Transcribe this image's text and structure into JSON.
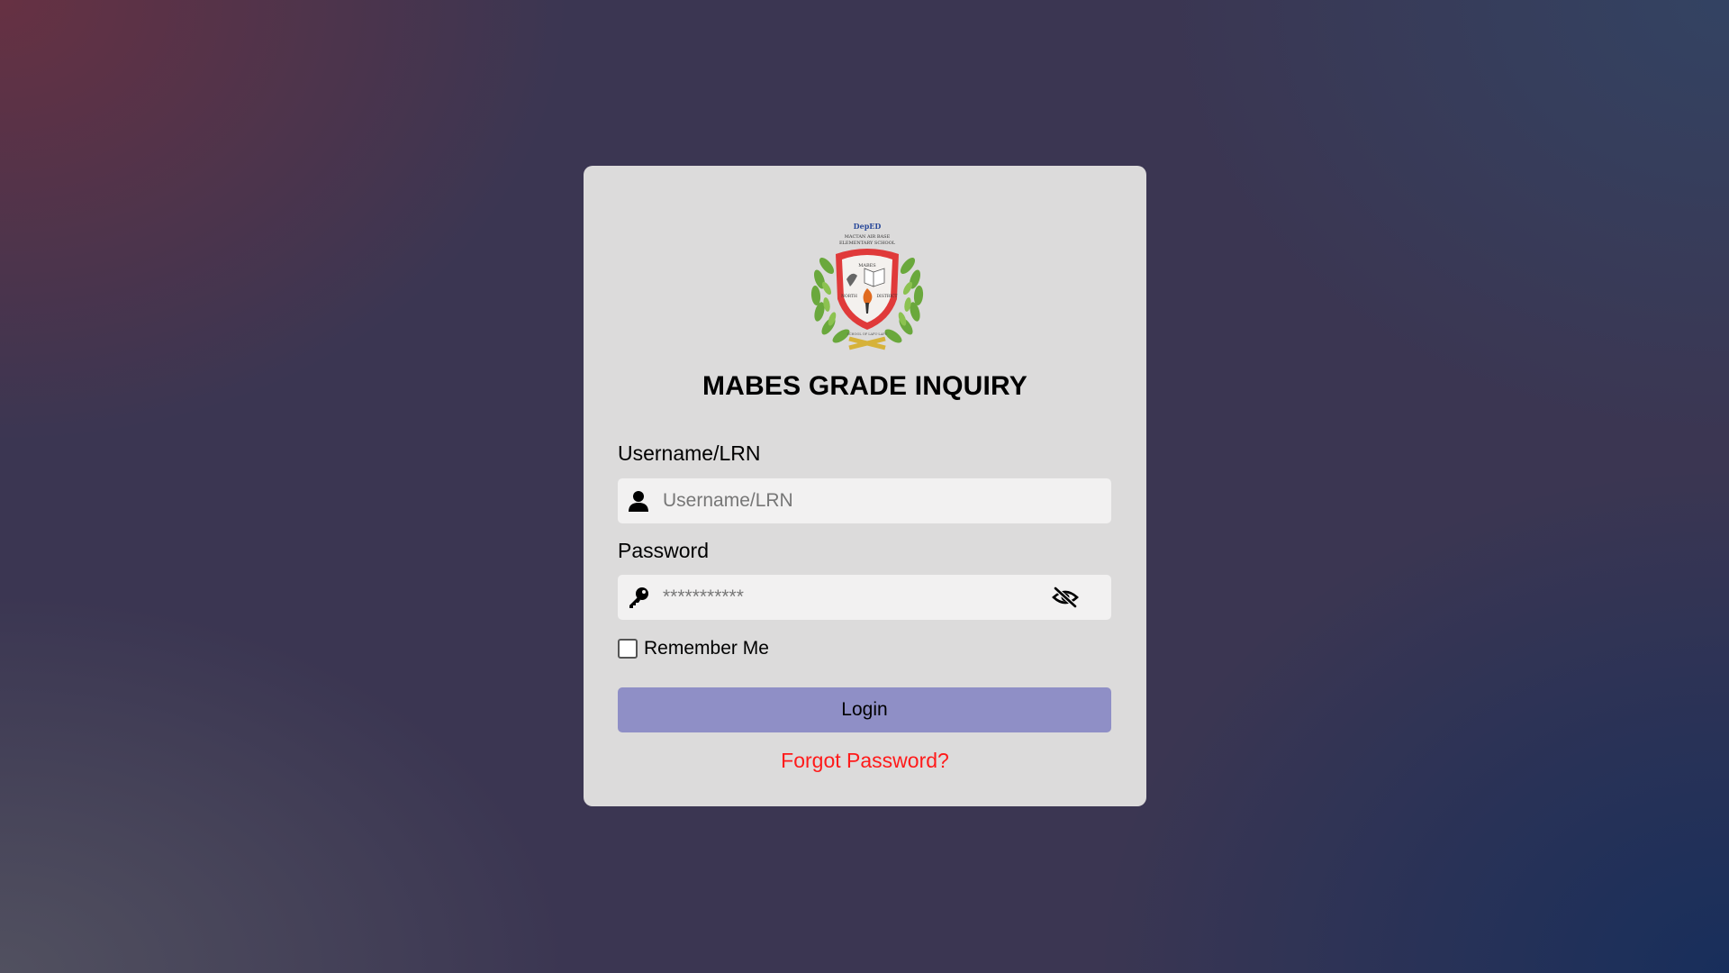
{
  "logo": {
    "top_text": "DepED",
    "ring_text": "MACTAN AIR BASE ELEMENTARY SCHOOL",
    "shield_text": "MABES",
    "left_text": "NORTH",
    "right_text": "DISTRICT",
    "bottom_text": "SCHOOL OF LAPU-LAPU"
  },
  "title": "MABES GRADE INQUIRY",
  "username": {
    "label": "Username/LRN",
    "placeholder": "Username/LRN",
    "value": "",
    "icon": "user-icon"
  },
  "password": {
    "label": "Password",
    "placeholder": "***********",
    "value": "",
    "icon": "key-icon",
    "toggle_icon": "eye-slash-icon"
  },
  "remember": {
    "label": "Remember Me",
    "checked": false
  },
  "login_button": "Login",
  "forgot_link": "Forgot Password?",
  "colors": {
    "card_bg": "#dcdbdb",
    "input_bg": "#f2f1f1",
    "button_bg": "#8f8fc6",
    "link": "#ff1a1a"
  }
}
